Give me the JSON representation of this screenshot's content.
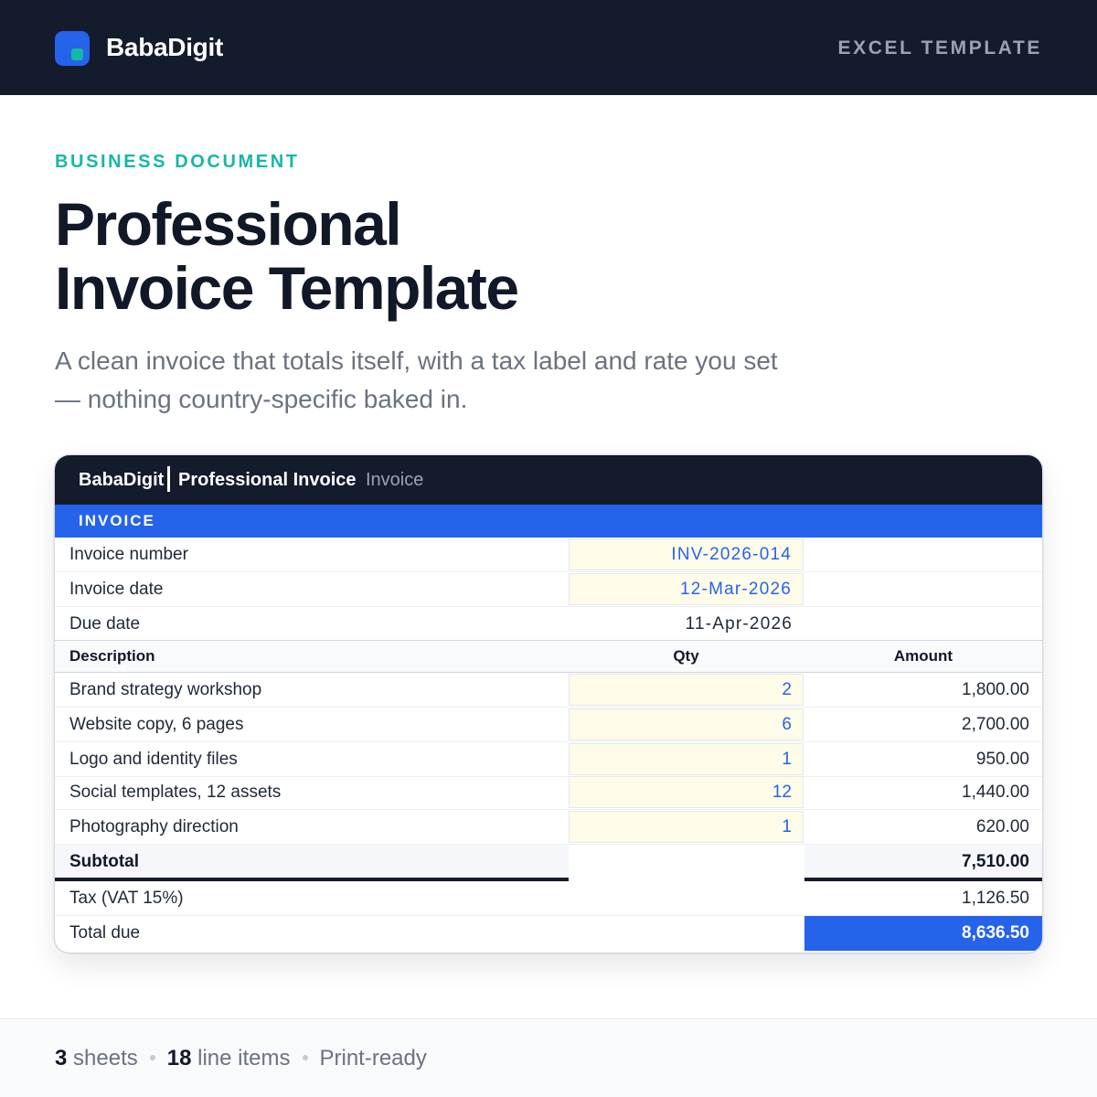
{
  "header": {
    "brand": "BabaDigit",
    "tag": "EXCEL TEMPLATE",
    "logo_icon": "square-logo-icon"
  },
  "hero": {
    "eyebrow": "BUSINESS DOCUMENT",
    "title_line1": "Professional",
    "title_line2": "Invoice Template",
    "subtitle": "A clean invoice that totals itself, with a tax label and rate you set — nothing country-specific baked in."
  },
  "sheet": {
    "brand": "BabaDigit",
    "title": "Professional Invoice",
    "sheet_name": "Invoice",
    "band": "INVOICE",
    "meta": [
      {
        "label": "Invoice number",
        "value": "INV-2026-014"
      },
      {
        "label": "Invoice date",
        "value": "12-Mar-2026"
      },
      {
        "label": "Due date",
        "value": "11-Apr-2026"
      }
    ],
    "columns": {
      "description": "Description",
      "qty": "Qty",
      "amount": "Amount"
    },
    "items": [
      {
        "description": "Brand strategy workshop",
        "qty": "2",
        "amount": "1,800.00"
      },
      {
        "description": "Website copy, 6 pages",
        "qty": "6",
        "amount": "2,700.00"
      },
      {
        "description": "Logo and identity files",
        "qty": "1",
        "amount": "950.00"
      },
      {
        "description": "Social templates, 12 assets",
        "qty": "12",
        "amount": "1,440.00"
      },
      {
        "description": "Photography direction",
        "qty": "1",
        "amount": "620.00"
      }
    ],
    "subtotal": {
      "label": "Subtotal",
      "value": "7,510.00"
    },
    "tax": {
      "label": "Tax (VAT 15%)",
      "value": "1,126.50"
    },
    "total": {
      "label": "Total due",
      "value": "8,636.50"
    }
  },
  "footer": {
    "sheets_count": "3",
    "sheets_label": "sheets",
    "items_count": "18",
    "items_label": "line items",
    "print": "Print-ready"
  },
  "colors": {
    "navy": "#141b2d",
    "accent_blue": "#2563eb",
    "teal": "#14b8a6",
    "input_fill": "#fefce8"
  }
}
